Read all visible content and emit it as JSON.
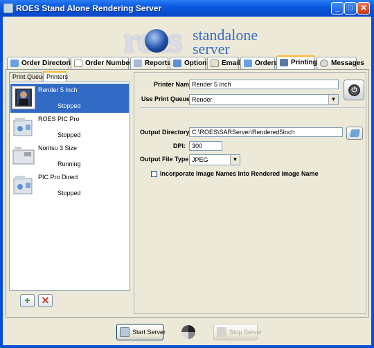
{
  "window": {
    "title": "ROES Stand Alone Rendering Server",
    "minimize": "_",
    "maximize": "□",
    "close": "✕"
  },
  "logo": {
    "word": "roes",
    "line1": "standalone",
    "line2": "server"
  },
  "tabs": [
    {
      "label": "Order Directories",
      "icon": "folder-icon",
      "color": "#6aa0e6"
    },
    {
      "label": "Order Numbers",
      "icon": "numbers-icon",
      "color": "#ffffff"
    },
    {
      "label": "Reports",
      "icon": "report-icon",
      "color": "#a7b9d6"
    },
    {
      "label": "Options",
      "icon": "options-icon",
      "color": "#5a8fd6"
    },
    {
      "label": "Email",
      "icon": "email-icon",
      "color": "#e8e1c5"
    },
    {
      "label": "Orders",
      "icon": "orders-icon",
      "color": "#6aa0e6"
    },
    {
      "label": "Printing",
      "icon": "printer-icon",
      "color": "#5b79a6",
      "active": true
    },
    {
      "label": "Messages",
      "icon": "messages-icon",
      "color": "#d9d9d9"
    }
  ],
  "subtabs": {
    "queues": "Print Queues",
    "printers": "Printers"
  },
  "printers": [
    {
      "name": "Render 5 Inch",
      "status": "Stopped",
      "selected": true
    },
    {
      "name": "ROES PIC Pro",
      "status": "Stopped"
    },
    {
      "name": "Noritsu 3 Size",
      "status": "Running"
    },
    {
      "name": "PIC Pro Direct",
      "status": "Stopped"
    }
  ],
  "scroll": {
    "left": "◄",
    "right": "►"
  },
  "buttons": {
    "add": "+",
    "remove": "✕",
    "power": "⏻"
  },
  "form": {
    "printer_name_label": "Printer Name:",
    "printer_name_value": "Render 5 Inch",
    "use_queue_label": "Use Print Queue:",
    "use_queue_value": "Render",
    "output_dir_label": "Output Directory:",
    "output_dir_value": "C:\\ROES\\SARServer\\Rendered5Inch",
    "dpi_label": "DPI:",
    "dpi_value": "300",
    "file_type_label": "Output File Type:",
    "file_type_value": "JPEG",
    "incorporate_label": "Incorporate Image Names Into Rendered Image Name",
    "incorporate_checked": false
  },
  "bottom": {
    "start": "Start Server",
    "stop": "Stop Server"
  }
}
